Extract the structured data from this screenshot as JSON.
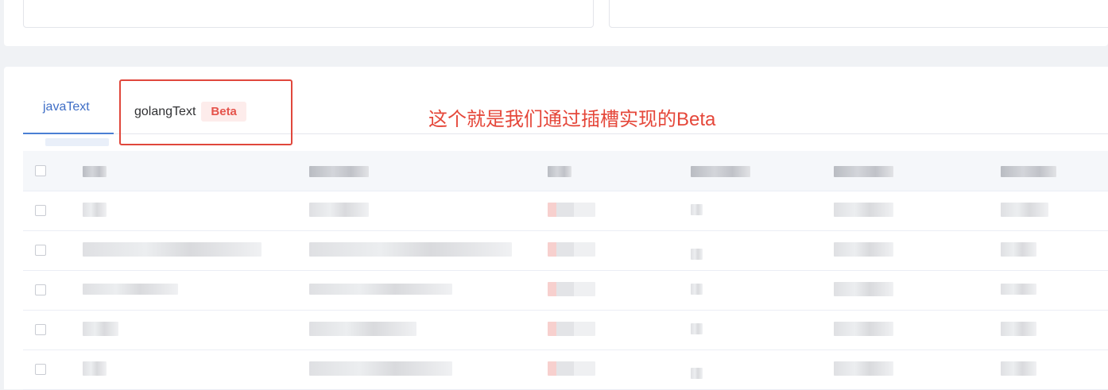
{
  "tabs": [
    {
      "label": "javaText",
      "active": true
    },
    {
      "label": "golangText",
      "active": false,
      "badge": "Beta"
    }
  ],
  "annotation": {
    "text": "这个就是我们通过插槽实现的Beta"
  },
  "colors": {
    "active_tab": "#3f6ec6",
    "badge_text": "#e5534b",
    "badge_bg": "#fdeceb",
    "annotation_red": "#e0473c"
  },
  "table": {
    "header_obscured": true,
    "rows_obscured": 5
  }
}
